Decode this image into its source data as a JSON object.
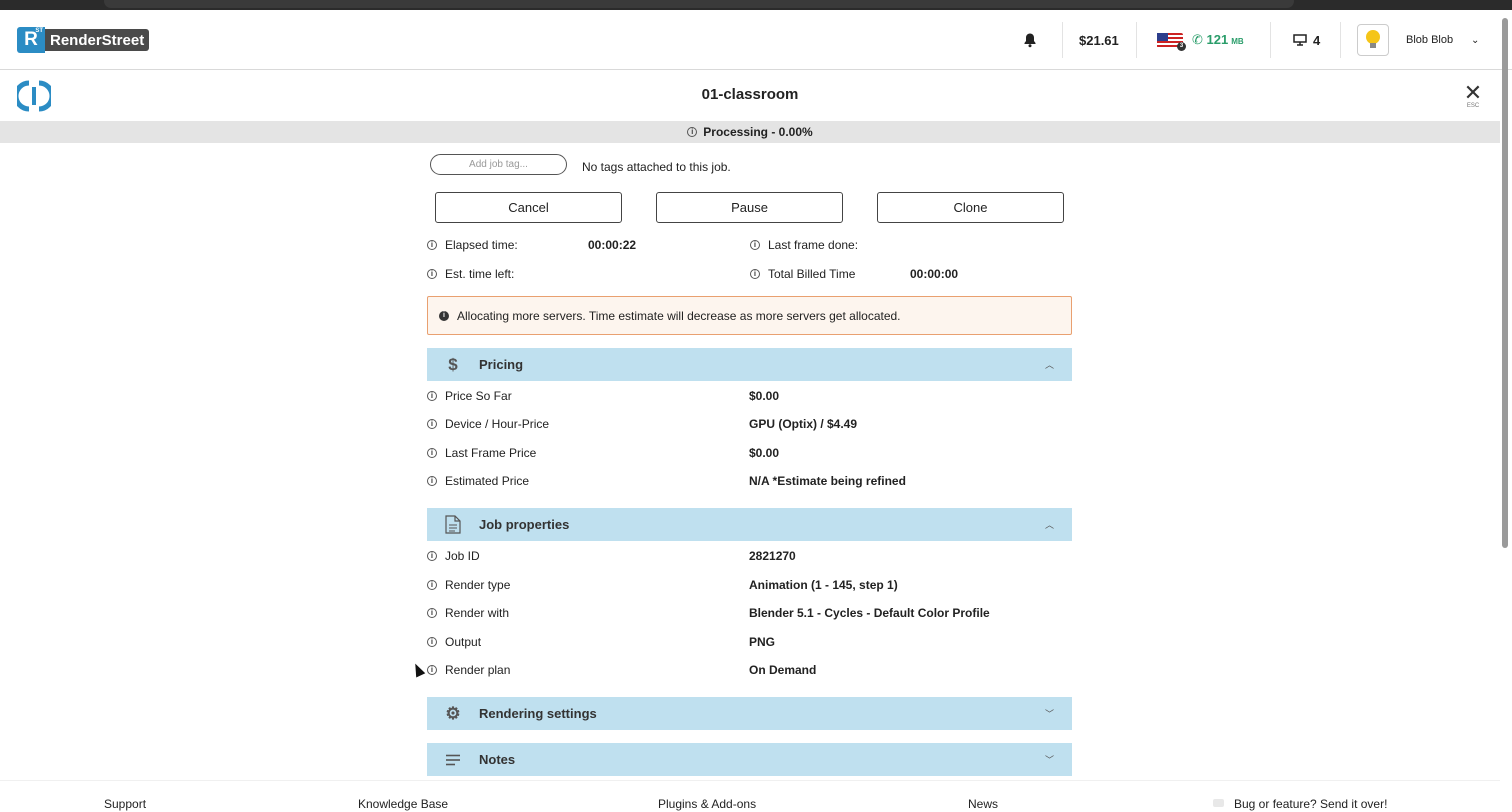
{
  "brand": {
    "logo_mark": "R",
    "logo_sup": "ST",
    "name": "RenderStreet"
  },
  "topbar": {
    "bell_icon": "bell-icon",
    "balance": "$21.61",
    "storage_value": "121",
    "storage_unit": "MB",
    "servers_count": "4",
    "user_name": "Blob Blob"
  },
  "job": {
    "title": "01-classroom",
    "close_label": "ESC",
    "status": "Processing - 0.00%"
  },
  "tags": {
    "placeholder": "Add job tag...",
    "empty_text": "No tags attached to this job."
  },
  "actions": {
    "cancel": "Cancel",
    "pause": "Pause",
    "clone": "Clone"
  },
  "stats": {
    "elapsed_label": "Elapsed time:",
    "elapsed_value": "00:00:22",
    "last_frame_label": "Last frame done:",
    "time_left_label": "Est. time left:",
    "billed_label": "Total Billed Time",
    "billed_value": "00:00:00"
  },
  "alert": {
    "text": "Allocating more servers. Time estimate will decrease as more servers get allocated."
  },
  "pricing": {
    "title": "Pricing",
    "rows": [
      {
        "label": "Price So Far",
        "value": "$0.00"
      },
      {
        "label": "Device / Hour-Price",
        "value": "GPU (Optix) / $4.49"
      },
      {
        "label": "Last Frame Price",
        "value": "$0.00"
      },
      {
        "label": "Estimated Price",
        "value": "N/A *Estimate being refined"
      }
    ]
  },
  "job_properties": {
    "title": "Job properties",
    "rows": [
      {
        "label": "Job ID",
        "value": "2821270"
      },
      {
        "label": "Render type",
        "value": "Animation (1 - 145, step 1)"
      },
      {
        "label": "Render with",
        "value": "Blender 5.1 - Cycles - Default Color Profile"
      },
      {
        "label": "Output",
        "value": "PNG"
      },
      {
        "label": "Render plan",
        "value": "On Demand"
      }
    ]
  },
  "rendering_settings": {
    "title": "Rendering settings"
  },
  "notes": {
    "title": "Notes"
  },
  "footer": {
    "support": "Support",
    "knowledge_base": "Knowledge Base",
    "plugins": "Plugins & Add-ons",
    "news": "News",
    "feedback": "Bug or feature? Send it over!"
  }
}
